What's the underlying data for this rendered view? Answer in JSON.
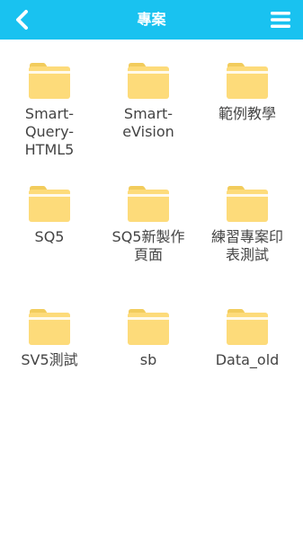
{
  "header": {
    "title": "專案",
    "back_icon": "chevron-left-icon",
    "menu_icon": "hamburger-menu-icon",
    "color": "#19c2f0"
  },
  "folder_colors": {
    "tab": "#f2cc5c",
    "body": "#fddb7a",
    "band": "#ffffff"
  },
  "folders": [
    {
      "label": "Smart-\nQuery-\nHTML5"
    },
    {
      "label": "Smart-\neVision"
    },
    {
      "label": "範例教學"
    },
    {
      "label": "SQ5"
    },
    {
      "label": "SQ5新製作\n頁面"
    },
    {
      "label": "練習專案印\n表測試"
    },
    {
      "label": "SV5測試"
    },
    {
      "label": "sb"
    },
    {
      "label": "Data_old"
    }
  ]
}
